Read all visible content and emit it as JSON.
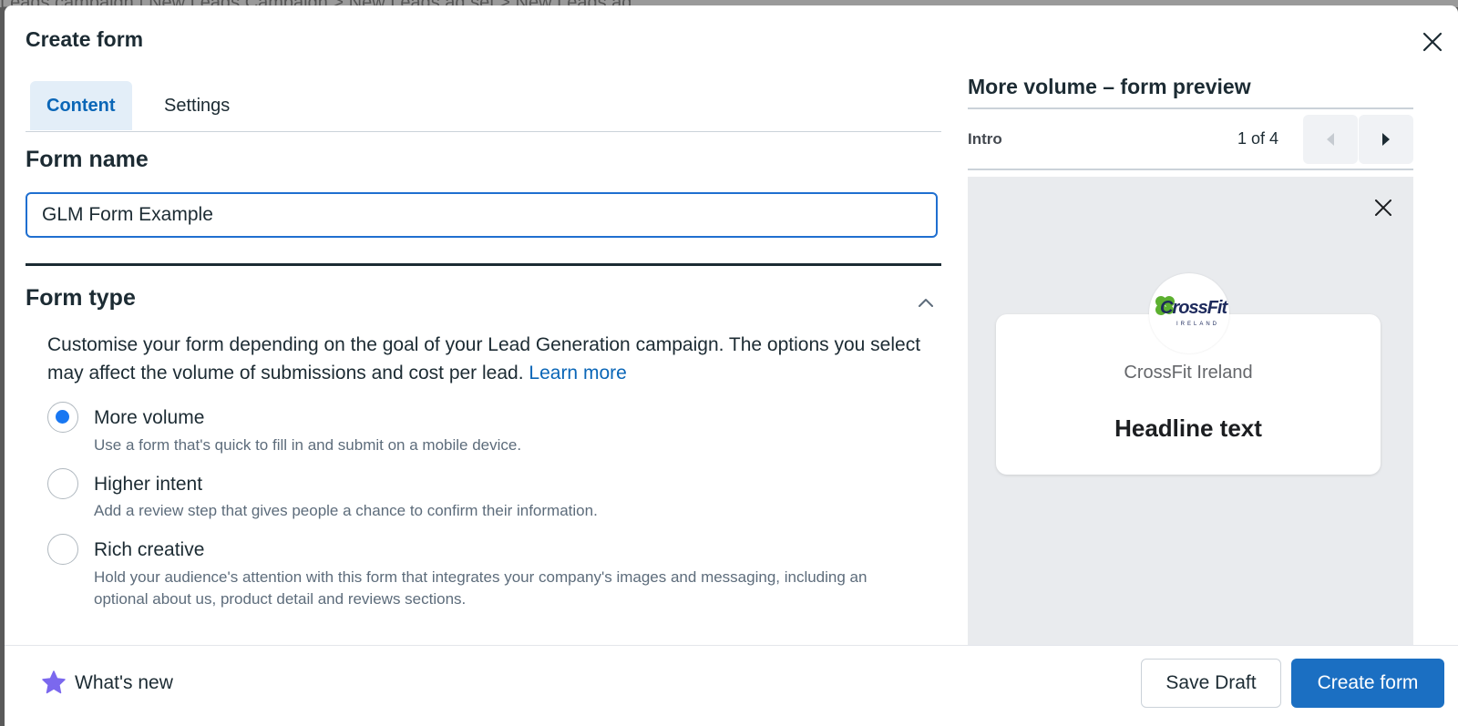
{
  "background": {
    "text": "Leads campaign   |   New Leads Campaign  >  New Leads ad set  >  New Leads ad"
  },
  "modal": {
    "title": "Create form",
    "close_icon": "close-icon"
  },
  "tabs": [
    {
      "label": "Content",
      "active": true
    },
    {
      "label": "Settings",
      "active": false
    }
  ],
  "form_name": {
    "title": "Form name",
    "value": "GLM Form Example"
  },
  "form_type": {
    "title": "Form type",
    "description": "Customise your form depending on the goal of your Lead Generation campaign. The options you select may affect the volume of submissions and cost per lead.",
    "learn_more": "Learn more",
    "options": [
      {
        "label": "More volume",
        "description": "Use a form that's quick to fill in and submit on a mobile device.",
        "selected": true
      },
      {
        "label": "Higher intent",
        "description": "Add a review step that gives people a chance to confirm their information.",
        "selected": false
      },
      {
        "label": "Rich creative",
        "description": "Hold your audience's attention with this form that integrates your company's images and messaging, including an optional about us, product detail and reviews sections.",
        "selected": false
      }
    ]
  },
  "preview": {
    "title": "More volume – form preview",
    "step": "Intro",
    "page": "1 of 4",
    "page_name": "CrossFit Ireland",
    "headline": "Headline text",
    "logo_text": "CrossFit",
    "logo_sub": "IRELAND"
  },
  "footer": {
    "whats_new": "What's new",
    "save_draft": "Save Draft",
    "create_form": "Create form"
  },
  "colors": {
    "accent": "#1b6fc2",
    "tab_active_bg": "#e3eef8",
    "radio_checked": "#1877f2",
    "star": "#7b68ee"
  }
}
